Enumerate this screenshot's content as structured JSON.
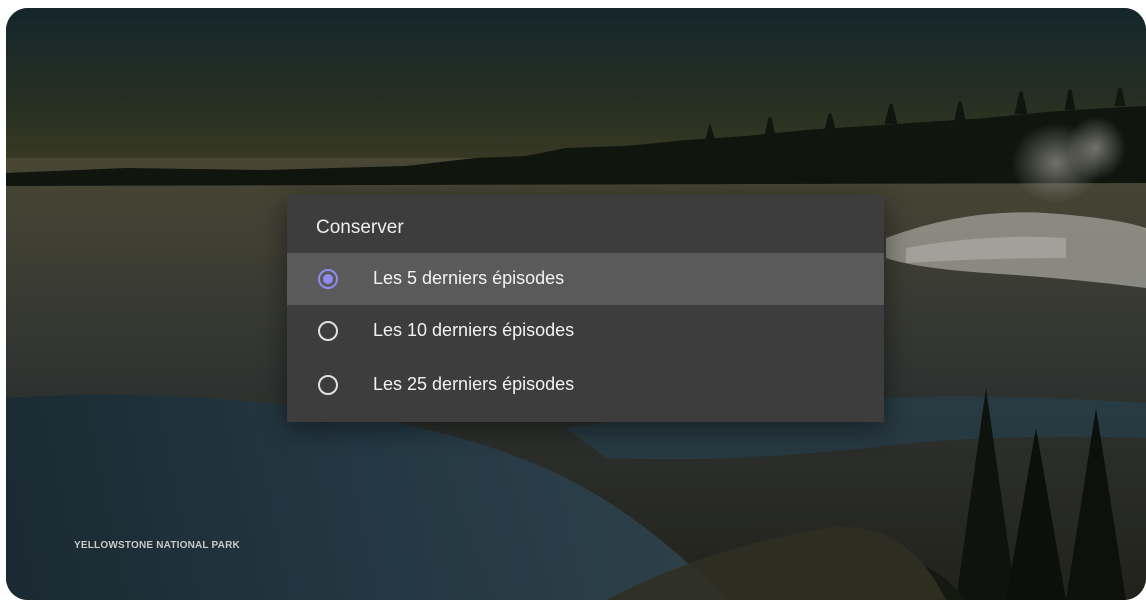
{
  "background": {
    "caption": "YELLOWSTONE NATIONAL PARK"
  },
  "dialog": {
    "title": "Conserver",
    "options": [
      {
        "label": "Les 5 derniers épisodes",
        "selected": true
      },
      {
        "label": "Les 10 derniers épisodes",
        "selected": false
      },
      {
        "label": "Les 25 derniers épisodes",
        "selected": false
      }
    ]
  },
  "colors": {
    "accent": "#8e8cf0",
    "dialog_bg": "#3d3d3d",
    "selected_row_bg": "#5a5a5a"
  }
}
